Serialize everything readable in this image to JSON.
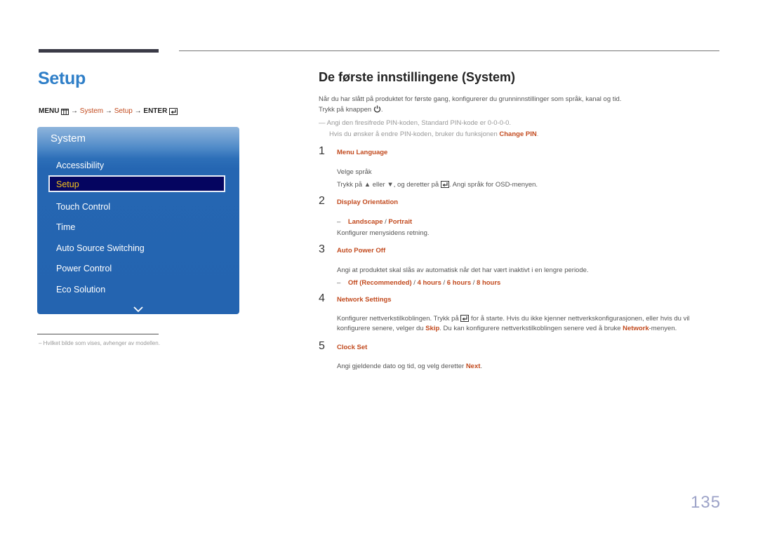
{
  "header": {
    "title": "Setup",
    "menu_path": {
      "menu": "MENU",
      "arrow": "→",
      "system": "System",
      "setup": "Setup",
      "enter": "ENTER"
    }
  },
  "osd_menu": {
    "title": "System",
    "items": [
      {
        "label": "Accessibility",
        "selected": false
      },
      {
        "label": "Setup",
        "selected": true
      },
      {
        "label": "Touch Control",
        "selected": false
      },
      {
        "label": "Time",
        "selected": false
      },
      {
        "label": "Auto Source Switching",
        "selected": false
      },
      {
        "label": "Power Control",
        "selected": false
      },
      {
        "label": "Eco Solution",
        "selected": false
      }
    ],
    "colors": {
      "panel": "#2464b0",
      "selected_bg": "#050560",
      "selected_text": "#f5c21b"
    }
  },
  "footnote": "Hvilket bilde som vises, avhenger av modellen.",
  "section": {
    "title": "De første innstillingene (System)",
    "intro_line1": "Når du har slått på produktet for første gang, konfigurerer du grunninnstillinger som språk, kanal og tid.",
    "intro_line2": "Trykk på knappen",
    "note_line1": "Angi den firesifrede PIN-koden, Standard PIN-kode er 0-0-0-0.",
    "note_line2_pre": "Hvis du ønsker å endre PIN-koden, bruker du funksjonen",
    "note_line2_hl": "Change PIN",
    "steps": [
      {
        "number": "1",
        "title": "Menu Language",
        "line1": "Velge språk",
        "line2_a": "Trykk på",
        "line2_b": "eller",
        "line2_c": ", og deretter på",
        "line2_d": ". Angi språk for OSD-menyen."
      },
      {
        "number": "2",
        "title": "Display Orientation",
        "options": [
          "Landscape",
          "Portrait"
        ],
        "desc": "Konfigurer menysidens retning."
      },
      {
        "number": "3",
        "title": "Auto Power Off",
        "desc": "Angi at produktet skal slås av automatisk når det har vært inaktivt i en lengre periode.",
        "options": [
          "Off (Recommended)",
          "4 hours",
          "6 hours",
          "8 hours"
        ]
      },
      {
        "number": "4",
        "title": "Network Settings",
        "line1_a": "Konfigurer nettverkstilkoblingen. Trykk på",
        "line1_b": "for å starte. Hvis du ikke kjenner nettverkskonfigurasjonen, eller hvis du vil",
        "line2_a": "konfigurere senere, velger du",
        "line2_skip": "Skip",
        "line2_b": ". Du kan konfigurere nettverkstilkoblingen senere ved å bruke",
        "line2_network": "Network",
        "line2_c": "-menyen."
      },
      {
        "number": "5",
        "title": "Clock Set",
        "desc_a": "Angi gjeldende dato og tid, og velg deretter",
        "desc_next": "Next"
      }
    ]
  },
  "page_number": "135",
  "colors": {
    "title_blue": "#2f7fc8",
    "accent": "#c24a1e"
  }
}
